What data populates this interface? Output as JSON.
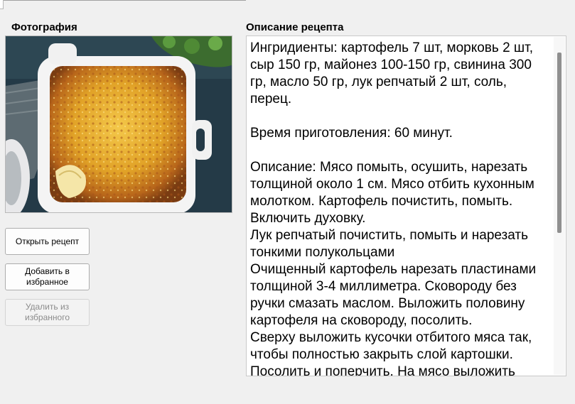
{
  "labels": {
    "photo": "Фотография",
    "description": "Описание рецепта"
  },
  "photo": {
    "subject": "baked potato gratin in white dish"
  },
  "buttons": {
    "open_recipe": "Открыть рецепт",
    "add_favorite": "Добавить в избранное",
    "remove_favorite": "Удалить из избранного"
  },
  "button_states": {
    "remove_favorite_enabled": false
  },
  "description_text": "Ингридиенты: картофель 7 шт, морковь 2 шт, сыр 150 гр, майонез 100-150 гр, свинина 300 гр, масло 50 гр, лук репчатый 2 шт, соль, перец.\n\nВремя приготовления: 60 минут.\n\nОписание: Мясо помыть, осушить, нарезать толщиной около 1 см. Мясо отбить кухонным молотком. Картофель почистить, помыть. Включить духовку.\nЛук репчатый почистить, помыть и нарезать тонкими полукольцами\nОчищенный картофель нарезать пластинами толщиной 3-4 миллиметра. Сковороду без ручки смазать маслом. Выложить половину картофеля на сковороду, посолить.\nСверху выложить кусочки отбитого мяса так, чтобы полностью закрыть слой картошки. Посолить и поперчить. На мясо выложить",
  "colors": {
    "window_bg": "#f0f0f0",
    "text": "#000000",
    "disabled_text": "#8c8c8c"
  }
}
